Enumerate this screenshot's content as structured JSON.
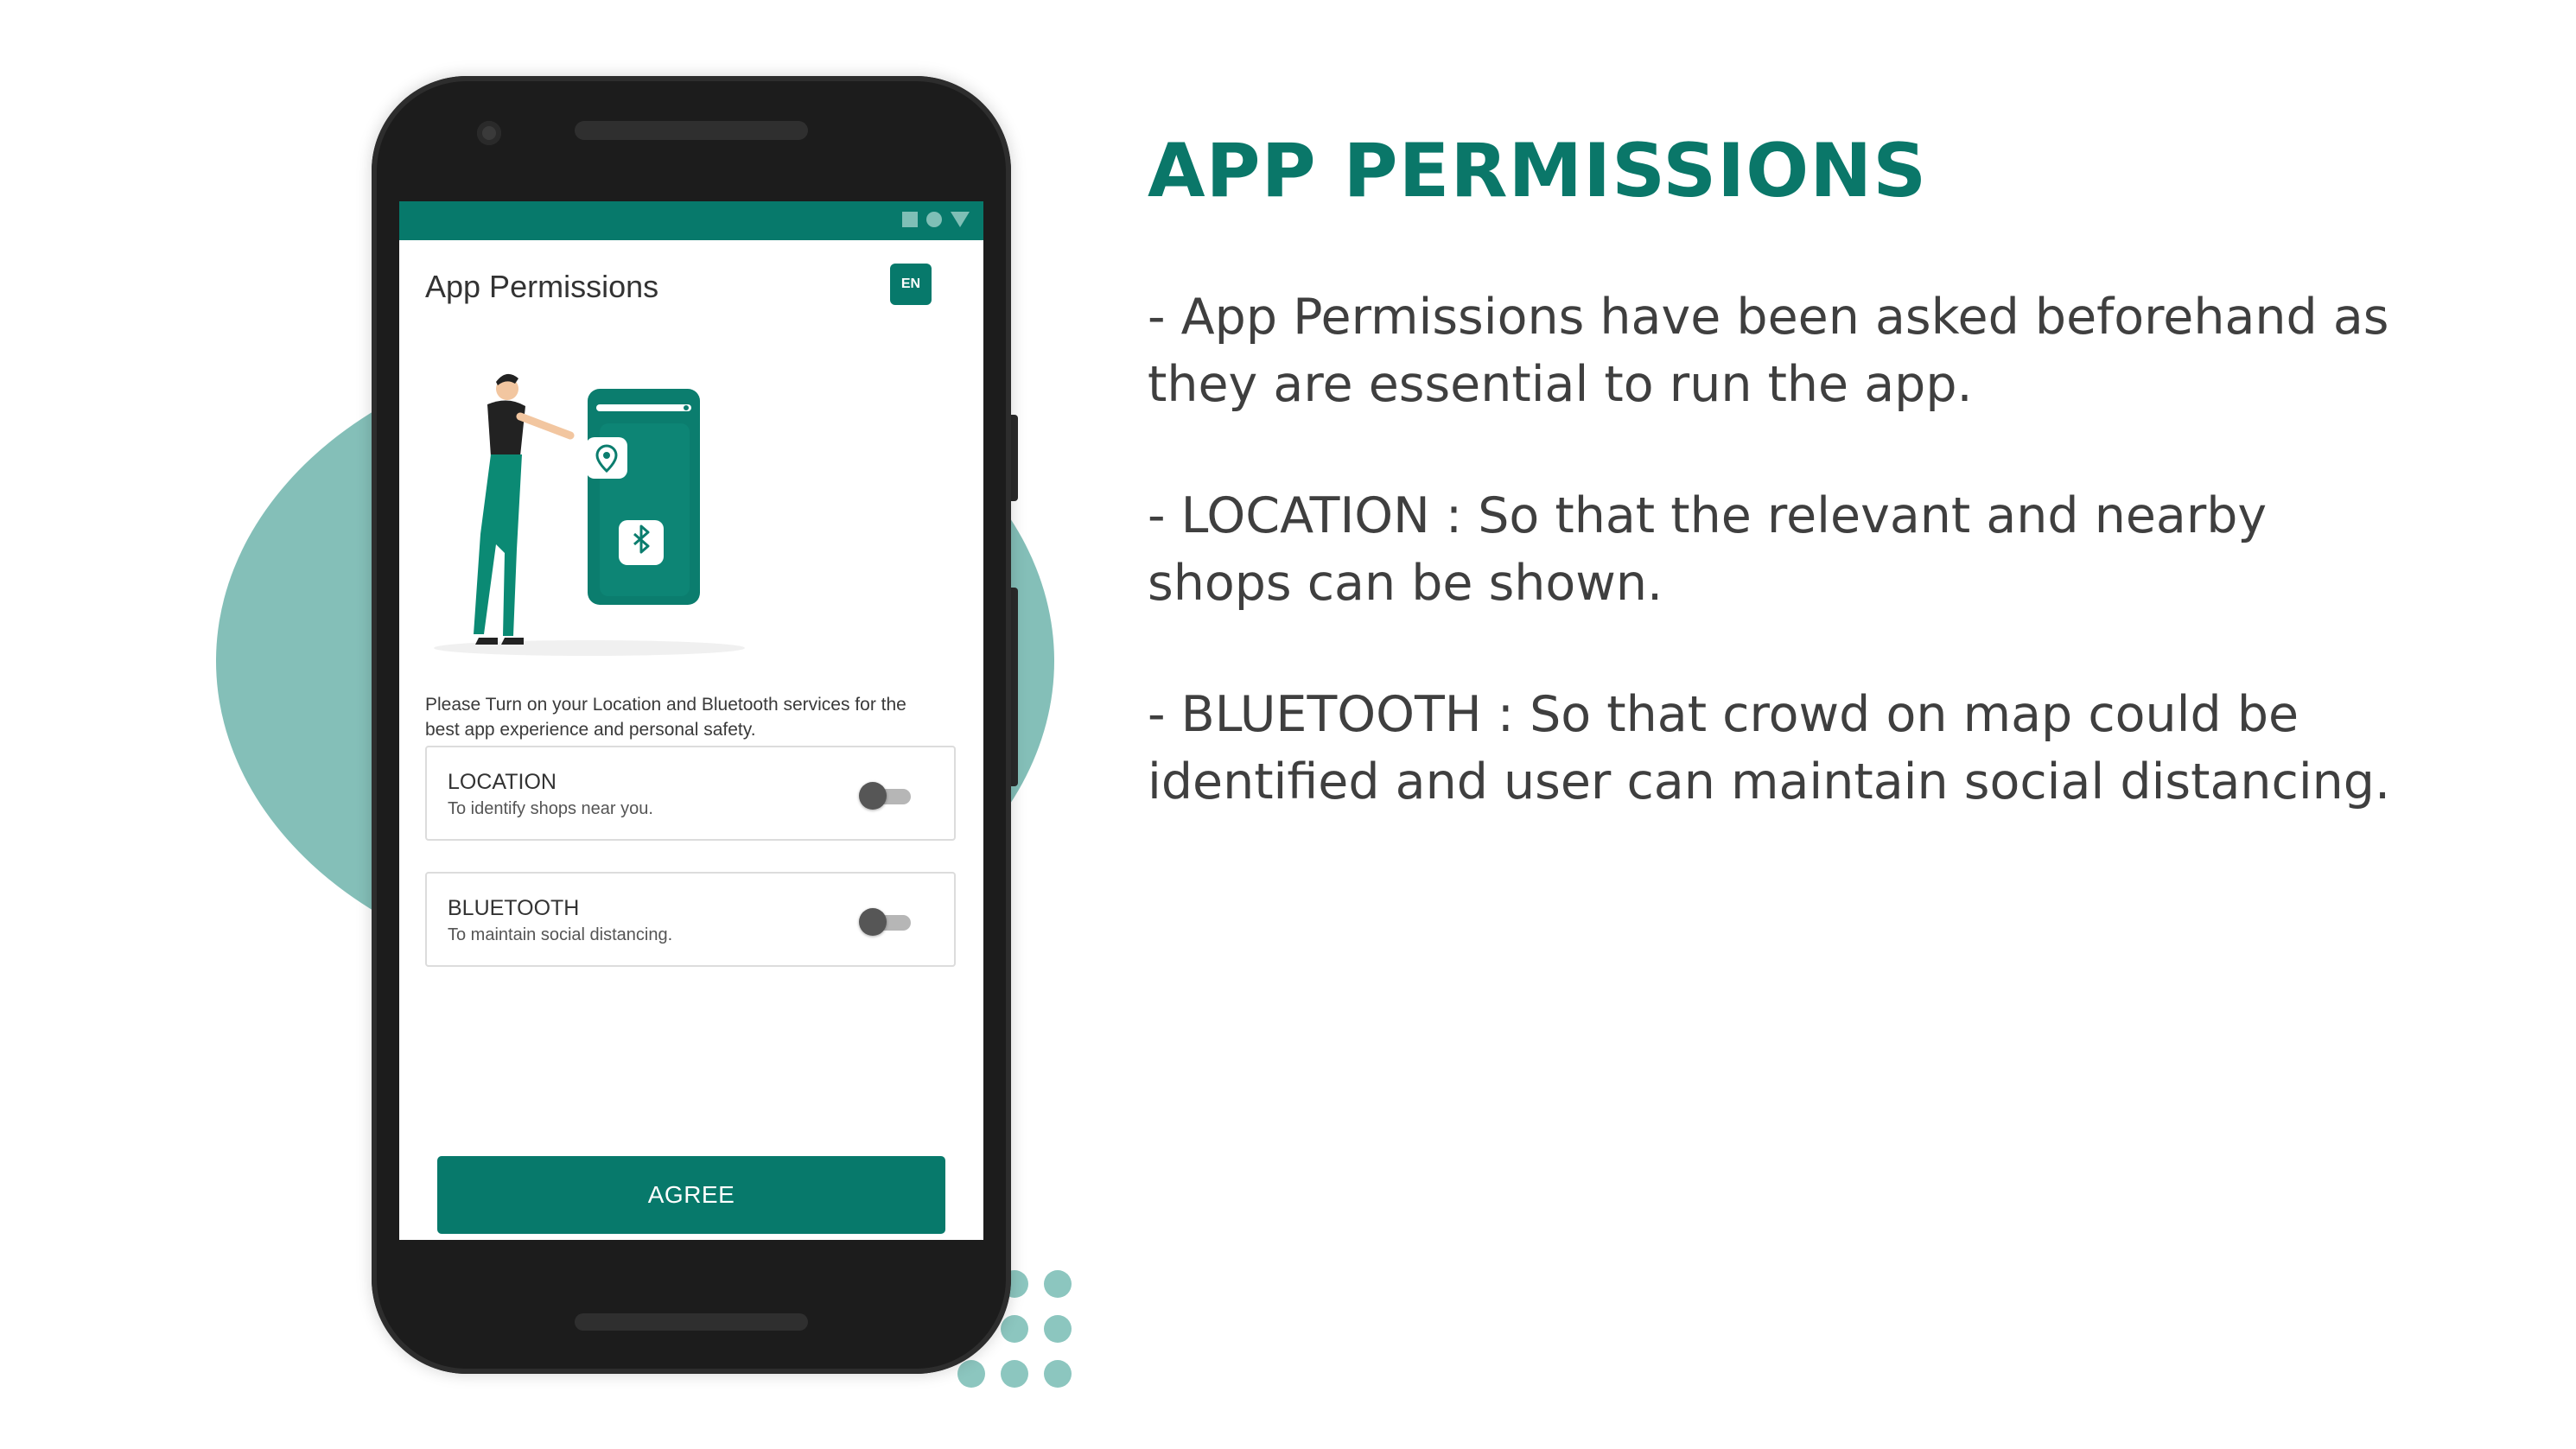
{
  "colors": {
    "accent": "#07796b",
    "blob": "#84bfb8",
    "heading": "#0a7769"
  },
  "slide": {
    "heading": "APP PERMISSIONS",
    "points": [
      "- App Permissions have been asked beforehand as they are essential to run the app.",
      "- LOCATION : So that the relevant and nearby shops can be shown.",
      "- BLUETOOTH : So that crowd on map could be identified and user can maintain social distancing."
    ]
  },
  "phone_screen": {
    "status_icons": [
      "square-icon",
      "circle-icon",
      "triangle-icon"
    ],
    "title": "App Permissions",
    "language_badge": "EN",
    "illustration_icons": [
      "location-pin-icon",
      "bluetooth-icon"
    ],
    "notice": "Please Turn on your Location and Bluetooth services for the best app experience and personal safety.",
    "permissions": [
      {
        "title": "LOCATION",
        "description": "To identify shops near you.",
        "enabled": false
      },
      {
        "title": "BLUETOOTH",
        "description": "To maintain social distancing.",
        "enabled": false
      }
    ],
    "agree_button": "AGREE"
  }
}
